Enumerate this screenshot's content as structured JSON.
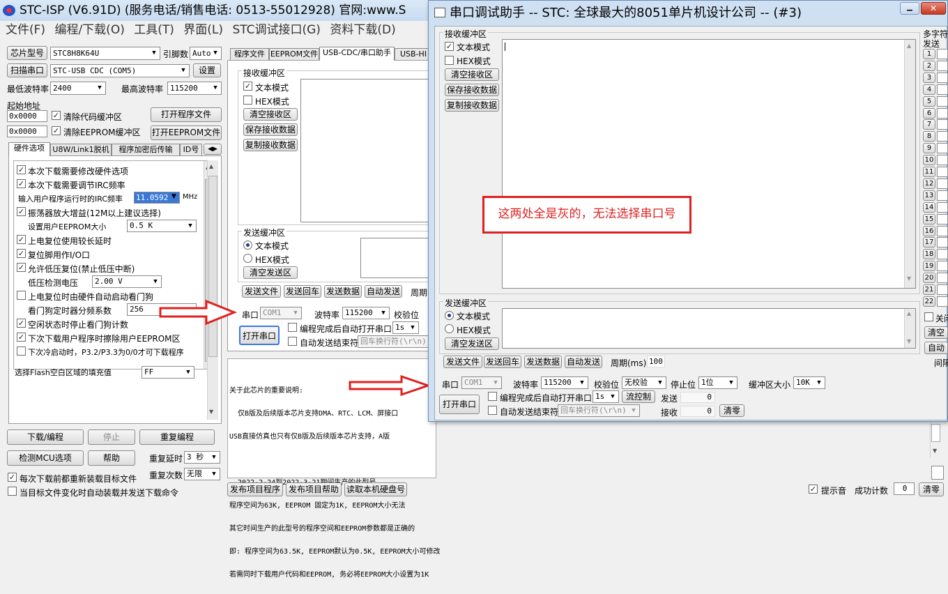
{
  "main_window": {
    "title": "STC-ISP (V6.91D) (服务电话/销售电话: 0513-55012928) 官网:www.S",
    "menu": [
      "文件(F)",
      "编程/下载(O)",
      "工具(T)",
      "界面(L)",
      "STC调试接口(G)",
      "资料下载(D)"
    ],
    "mcu_type_label": "芯片型号",
    "mcu_type_value": "STC8H8K64U",
    "pins_label": "引脚数",
    "pins_value": "Auto",
    "scan_port_label": "扫描串口",
    "port_value": "STC-USB CDC (COM5)",
    "settings_label": "设置",
    "min_baud_label": "最低波特率",
    "min_baud_value": "2400",
    "max_baud_label": "最高波特率",
    "max_baud_value": "115200",
    "start_addr_label": "起始地址",
    "addr1": "0x0000",
    "clear_code_label": "清除代码缓冲区",
    "open_prog_label": "打开程序文件",
    "addr2": "0x0000",
    "clear_eeprom_label": "清除EEPROM缓冲区",
    "open_eeprom_label": "打开EEPROM文件",
    "hw_tabs": [
      "硬件选项",
      "U8W/Link1脱机",
      "程序加密后传输",
      "ID号"
    ],
    "hw_options": {
      "opt1": "本次下载需要修改硬件选项",
      "opt2": "本次下载需要调节IRC频率",
      "irc_label": "输入用户程序运行时的IRC频率",
      "irc_value": "11.0592",
      "irc_unit": "MHz",
      "opt3": "振荡器放大增益(12M以上建议选择)",
      "eeprom_label": "设置用户EEPROM大小",
      "eeprom_value": "0.5 K",
      "opt4": "上电复位使用较长延时",
      "opt5": "复位脚用作I/O口",
      "opt6": "允许低压复位(禁止低压中断)",
      "lvd_label": "低压检测电压",
      "lvd_value": "2.00 V",
      "opt7": "上电复位时由硬件自动启动看门狗",
      "wdt_label": "看门狗定时器分频系数",
      "wdt_value": "256",
      "opt8": "空闲状态时停止看门狗计数",
      "opt9": "下次下载用户程序时擦除用户EEPROM区",
      "opt10": "下次冷启动时，P3.2/P3.3为0/0才可下载程序",
      "flash_fill_label": "选择Flash空白区域的填充值",
      "flash_fill_value": "FF"
    },
    "download_label": "下载/编程",
    "stop_label": "停止",
    "reprogram_label": "重复编程",
    "detect_label": "检测MCU选项",
    "help_label": "帮助",
    "retry_delay_label": "重复延时",
    "retry_delay_value": "3 秒",
    "retry_count_label": "重复次数",
    "retry_count_value": "无限",
    "reload_label": "每次下载前都重新装载目标文件",
    "auto_send_label": "当目标文件变化时自动装载并发送下载命令",
    "right_tabs": [
      "程序文件",
      "EEPROM文件",
      "USB-CDC/串口助手",
      "USB-HI"
    ],
    "recv_group": "接收缓冲区",
    "text_mode": "文本模式",
    "hex_mode": "HEX模式",
    "clear_recv": "清空接收区",
    "save_recv": "保存接收数据",
    "copy_recv": "复制接收数据",
    "send_group": "发送缓冲区",
    "clear_send": "清空发送区",
    "send_file": "发送文件",
    "send_enter": "发送回车",
    "send_data": "发送数据",
    "auto_send": "自动发送",
    "period_label": "周期",
    "port_label": "串口",
    "port_sel": "COM1",
    "baud_label": "波特率",
    "baud_sel": "115200",
    "parity_label": "校验位",
    "open_port": "打开串口",
    "auto_open_label": "编程完成后自动打开串口",
    "auto_open_value": "1s",
    "auto_send_end_label": "自动发送结束符",
    "end_char_value": "回车换行符(\\r\\n)",
    "info_text": [
      "关于此芯片的重要说明:",
      "  仅B版及后续版本芯片支持DMA、RTC、LCM、屏接口",
      "USB直接仿真也只有仅B版及后续版本芯片支持，A版",
      "",
      "  2022-2-24到2022-3-21期间生产的此型号",
      "程序空间为63K, EEPROM 固定为1K, EEPROM大小无法",
      "其它时间生产的此型号的程序空间和EEPROM参数都是正确的",
      "即: 程序空间为63.5K, EEPROM默认为0.5K, EEPROM大小可修改",
      "若需同时下载用户代码和EEPROM, 务必将EEPROM大小设置为1K"
    ],
    "publish_prog": "发布项目程序",
    "publish_help": "发布项目帮助",
    "read_disk": "读取本机硬盘号",
    "beep_label": "提示音",
    "success_label": "成功计数",
    "success_value": "0",
    "clear_label": "清零"
  },
  "serial_window": {
    "title": "串口调试助手 -- STC: 全球最大的8051单片机设计公司 -- (#3)",
    "recv_group": "接收缓冲区",
    "text_mode": "文本模式",
    "hex_mode": "HEX模式",
    "clear_recv": "清空接收区",
    "save_recv": "保存接收数据",
    "copy_recv": "复制接收数据",
    "send_group": "发送缓冲区",
    "clear_send": "清空发送区",
    "send_file": "发送文件",
    "send_enter": "发送回车",
    "send_data": "发送数据",
    "auto_send": "自动发送",
    "period_label": "周期(ms)",
    "period_value": "100",
    "port_label": "串口",
    "port_value": "COM1",
    "baud_label": "波特率",
    "baud_value": "115200",
    "parity_label": "校验位",
    "parity_value": "无校验",
    "stop_label": "停止位",
    "stop_value": "1位",
    "buffer_label": "缓冲区大小",
    "buffer_value": "10K",
    "open_port": "打开串口",
    "auto_open_label": "编程完成后自动打开串口",
    "auto_open_value": "1s",
    "flow_label": "流控制",
    "send_count_label": "发送",
    "send_count": "0",
    "recv_count_label": "接收",
    "recv_count": "0",
    "clear_count": "清零",
    "auto_end_label": "自动发送结束符",
    "end_char_value": "回车换行符(\\r\\n)",
    "multi_title": "多字符",
    "multi_send_label": "发送",
    "multi_rows": [
      "1",
      "2",
      "3",
      "4",
      "5",
      "6",
      "7",
      "8",
      "9",
      "10",
      "11",
      "12",
      "13",
      "14",
      "15",
      "16",
      "17",
      "18",
      "19",
      "20",
      "21",
      "22"
    ],
    "right_close_label": "关闭",
    "right_clear_label": "清空",
    "right_auto_label": "自动",
    "right_interval_label": "间隔"
  },
  "annotation": {
    "text": "这两处全是灰的，无法选择串口号"
  }
}
